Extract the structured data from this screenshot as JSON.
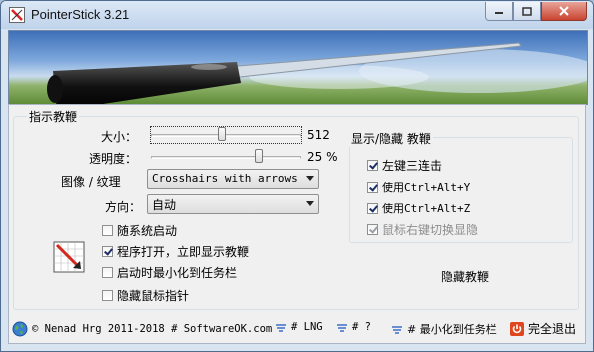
{
  "window": {
    "title": "PointerStick 3.21"
  },
  "pointer_group": {
    "title": "指示教鞭",
    "size_label": "大小：",
    "size_value": "512",
    "size_fraction": 0.47,
    "opacity_label": "透明度：",
    "opacity_value": "25 %",
    "opacity_fraction": 0.72,
    "image_label": "图像 / 纹理",
    "image_value": "Crosshairs with arrows (",
    "direction_label": "方向：",
    "direction_value": "自动"
  },
  "options": [
    {
      "label": "随系统启动",
      "checked": false
    },
    {
      "label": "程序打开，立即显示教鞭",
      "checked": true
    },
    {
      "label": "启动时最小化到任务栏",
      "checked": false
    },
    {
      "label": "隐藏鼠标指针",
      "checked": false
    }
  ],
  "toggle_group": {
    "title": "显示/隐藏 教鞭",
    "items": [
      {
        "label": "左键三连击",
        "checked": true,
        "enabled": true
      },
      {
        "label": "使用Ctrl+Alt+Y",
        "checked": true,
        "enabled": true
      },
      {
        "label": "使用Ctrl+Alt+Z",
        "checked": true,
        "enabled": true
      },
      {
        "label": "鼠标右键切换显隐",
        "checked": true,
        "enabled": false
      }
    ],
    "hide_button": "隐藏教鞭"
  },
  "footer": {
    "copyright": "© Nenad Hrg 2011-2018 # SoftwareOK.com",
    "lng": "# LNG",
    "help": "# ?",
    "minimize": "# 最小化到任务栏",
    "exit": "完全退出"
  },
  "colors": {
    "exit_icon": "#e0461e",
    "link_accent": "#3a6fc4"
  }
}
